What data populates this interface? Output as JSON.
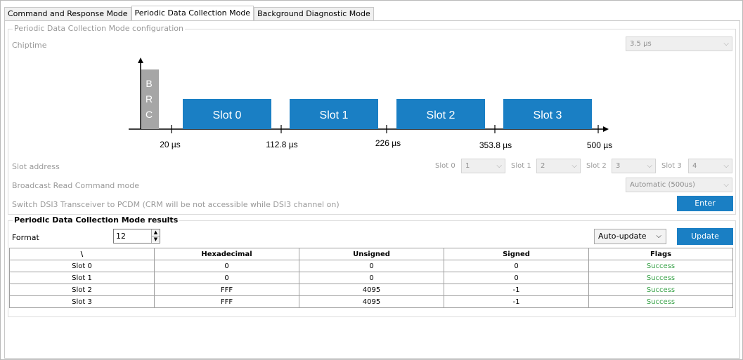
{
  "tabs": [
    {
      "label": "Command and Response Mode"
    },
    {
      "label": "Periodic Data Collection Mode"
    },
    {
      "label": "Background Diagnostic Mode"
    }
  ],
  "config": {
    "group_title": "Periodic Data Collection Mode configuration",
    "chiptime_label": "Chiptime",
    "chiptime_value": "3.5 µs",
    "slot_address_label": "Slot address",
    "slots": [
      {
        "label": "Slot 0",
        "value": "1"
      },
      {
        "label": "Slot 1",
        "value": "2"
      },
      {
        "label": "Slot 2",
        "value": "3"
      },
      {
        "label": "Slot 3",
        "value": "4"
      }
    ],
    "brc_mode_label": "Broadcast Read Command mode",
    "brc_mode_value": "Automatic (500us)",
    "switch_label": "Switch DSI3 Transceiver to PCDM (CRM will be not accessible while DSI3 channel on)",
    "enter_label": "Enter"
  },
  "diagram": {
    "brc_letters": [
      "B",
      "R",
      "C"
    ],
    "slot_labels": [
      "Slot 0",
      "Slot 1",
      "Slot 2",
      "Slot 3"
    ],
    "ticks": [
      "20 µs",
      "112.8 µs",
      "226 µs",
      "353.8 µs",
      "500 µs"
    ],
    "colors": {
      "slot": "#1a7fc4",
      "brc": "#a6a6a6"
    }
  },
  "results": {
    "group_title": "Periodic Data Collection Mode results",
    "format_label": "Format",
    "format_value": "12",
    "update_mode": "Auto-update",
    "update_label": "Update",
    "columns": [
      "\\",
      "Hexadecimal",
      "Unsigned",
      "Signed",
      "Flags"
    ],
    "rows": [
      [
        "Slot 0",
        "0",
        "0",
        "0",
        "Success"
      ],
      [
        "Slot 1",
        "0",
        "0",
        "0",
        "Success"
      ],
      [
        "Slot 2",
        "FFF",
        "4095",
        "-1",
        "Success"
      ],
      [
        "Slot 3",
        "FFF",
        "4095",
        "-1",
        "Success"
      ]
    ]
  }
}
